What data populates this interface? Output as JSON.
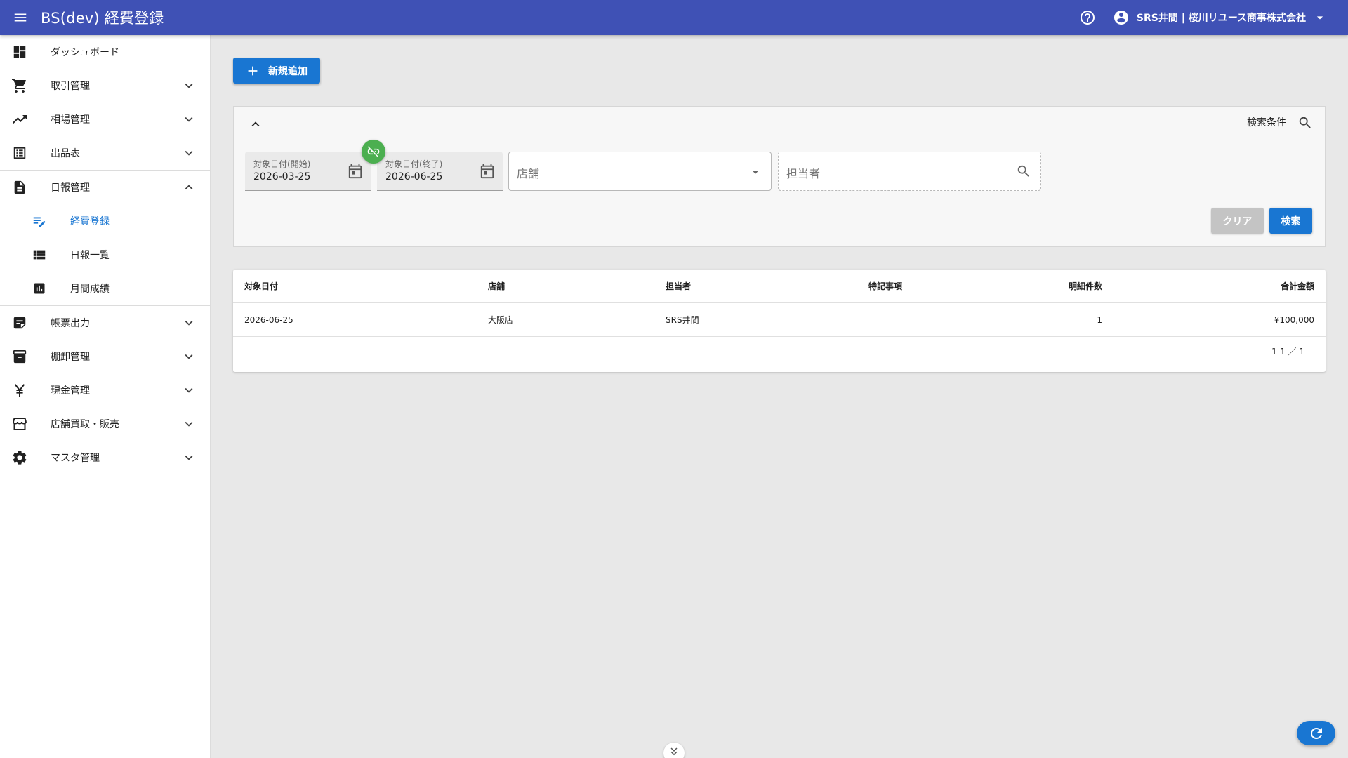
{
  "app": {
    "title": "BS(dev) 経費登録",
    "user_name": "SRS井間 | 桜川リユース商事株式会社",
    "accent_color": "#3f51b5",
    "primary_color": "#1976d2"
  },
  "sidebar": {
    "items": [
      {
        "label": "ダッシュボード",
        "icon": "dashboard-icon"
      },
      {
        "label": "取引管理",
        "icon": "cart-icon"
      },
      {
        "label": "相場管理",
        "icon": "trending-up-icon"
      },
      {
        "label": "出品表",
        "icon": "list-alt-icon"
      },
      {
        "label": "日報管理",
        "icon": "description-icon"
      },
      {
        "label": "帳票出力",
        "icon": "note-icon"
      },
      {
        "label": "棚卸管理",
        "icon": "archive-icon"
      },
      {
        "label": "現金管理",
        "icon": "yen-icon"
      },
      {
        "label": "店舗買取・販売",
        "icon": "storefront-icon"
      },
      {
        "label": "マスタ管理",
        "icon": "gear-icon"
      }
    ],
    "sub_items": [
      {
        "label": "経費登録",
        "icon": "edit-note-icon",
        "active": true
      },
      {
        "label": "日報一覧",
        "icon": "view-list-icon"
      },
      {
        "label": "月間成績",
        "icon": "bar-chart-icon"
      }
    ]
  },
  "toolbar": {
    "add_label": "新規追加"
  },
  "search": {
    "condition_label": "検索条件",
    "start_label": "対象日付(開始)",
    "start_value": "2026-03-25",
    "end_label": "対象日付(終了)",
    "end_value": "2026-06-25",
    "store_placeholder": "店舗",
    "person_placeholder": "担当者",
    "clear_label": "クリア",
    "search_label": "検索"
  },
  "table": {
    "headers": {
      "date": "対象日付",
      "store": "店舗",
      "person": "担当者",
      "note": "特記事項",
      "count": "明細件数",
      "total": "合計金額"
    },
    "rows": [
      {
        "date": "2026-06-25",
        "store": "大阪店",
        "person": "SRS井間",
        "note": "",
        "count": "1",
        "total": "¥100,000"
      }
    ],
    "pagination": "1-1 ／ 1"
  }
}
